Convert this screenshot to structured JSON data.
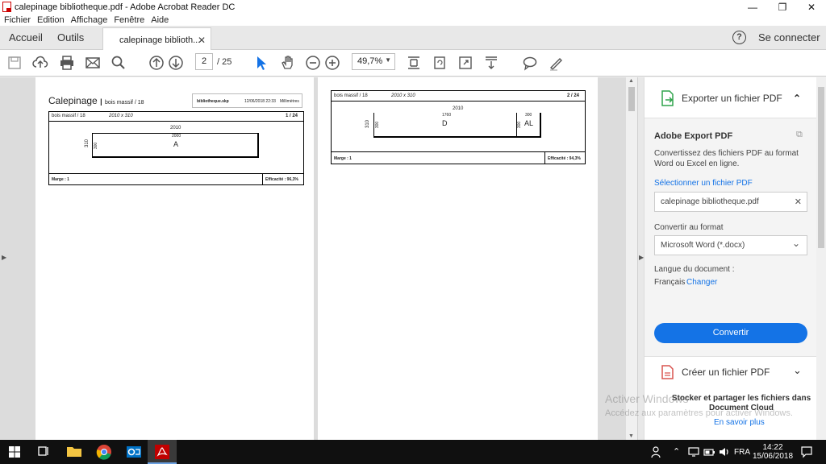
{
  "window": {
    "title": "calepinage bibliotheque.pdf - Adobe Acrobat Reader DC",
    "minimize": "—",
    "maximize": "❐",
    "close": "✕"
  },
  "menu": [
    "Fichier",
    "Edition",
    "Affichage",
    "Fenêtre",
    "Aide"
  ],
  "tabs": {
    "home": "Accueil",
    "tools": "Outils",
    "document": "calepinage biblioth...",
    "document_close": "✕",
    "help": "?",
    "connect": "Se connecter"
  },
  "toolbar": {
    "page_current": "2",
    "page_total": "/ 25",
    "zoom": "49,7%",
    "zoom_caret": "▼"
  },
  "page1": {
    "heading": "Calepinage",
    "heading_sub": "bois massif / 18",
    "file": "bibliotheque.skp",
    "date": "12/06/2018 22:33",
    "unit": "Millimètres",
    "sheet_label": "bois massif / 18",
    "sheet_size": "2010 x 310",
    "sheet_page": "1 / 24",
    "width": "2010",
    "height": "310",
    "piece_width": "2000",
    "piece_height": "300",
    "piece": "A",
    "marge": "Marge : 1",
    "efficacite": "Efficacité : 96,3%"
  },
  "page2": {
    "sheet_label": "bois massif / 18",
    "sheet_size": "2010 x 310",
    "sheet_page": "2 / 24",
    "width": "2010",
    "height": "310",
    "piece1_width": "1760",
    "piece1_height": "300",
    "piece1": "D",
    "piece2_width": "300",
    "piece2_height": "300",
    "piece2": "AL",
    "marge": "Marge : 1",
    "efficacite": "Efficacité : 94,3%"
  },
  "panel": {
    "export_title": "Exporter un fichier PDF",
    "export_caret": "⌃",
    "service_title": "Adobe Export PDF",
    "description": "Convertissez des fichiers PDF au format Word ou Excel en ligne.",
    "select_label": "Sélectionner un fichier PDF",
    "file_value": "calepinage bibliotheque.pdf",
    "clear": "✕",
    "convert_to_label": "Convertir au format",
    "format_value": "Microsoft Word (*.docx)",
    "format_caret": "⌄",
    "language_label": "Langue du document :",
    "language_value": "Français",
    "language_change": "Changer",
    "convert_button": "Convertir",
    "create_title": "Créer un fichier PDF",
    "create_caret": "⌄",
    "store_text": "Stocker et partager les fichiers dans Document Cloud",
    "learn_more": "En savoir plus"
  },
  "watermark": {
    "line1": "Activer Windows",
    "line2": "Accédez aux paramètres pour activer Windows."
  },
  "taskbar": {
    "lang": "FRA",
    "time": "14:22",
    "date": "15/06/2018"
  },
  "colors": {
    "accent": "#1473e6",
    "taskbar": "#101010",
    "acrobat_red": "#c00000"
  }
}
